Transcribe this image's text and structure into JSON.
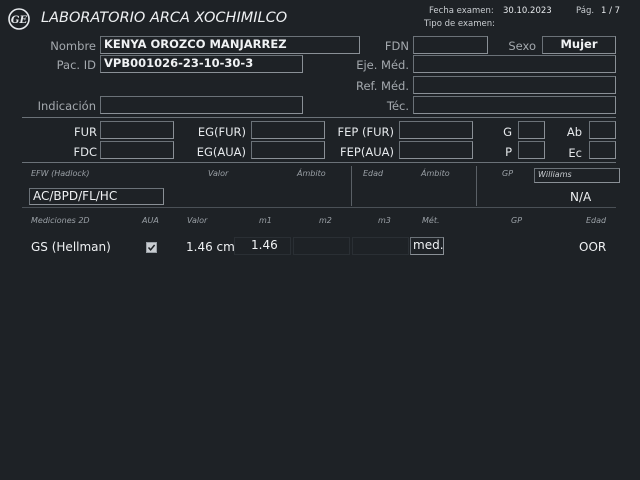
{
  "header": {
    "title": "LABORATORIO ARCA XOCHIMILCO",
    "exam_date_label": "Fecha examen:",
    "exam_date": "30.10.2023",
    "exam_type_label": "Tipo de examen:",
    "page_label": "Pág.",
    "page": "1 / 7"
  },
  "patient": {
    "name_label": "Nombre",
    "name": "KENYA OROZCO MANJARREZ",
    "dob_label": "FDN",
    "dob": "",
    "sex_label": "Sexo",
    "sex": "Mujer",
    "id_label": "Pac. ID",
    "id": "VPB001026-23-10-30-3",
    "exec_doc_label": "Eje. Méd.",
    "exec_doc": "",
    "ref_doc_label": "Ref. Méd.",
    "ref_doc": "",
    "indication_label": "Indicación",
    "indication": "",
    "tech_label": "Téc.",
    "tech": ""
  },
  "dates": {
    "fur_label": "FUR",
    "fur": "",
    "eg_fur_label": "EG(FUR)",
    "eg_fur": "",
    "fep_fur_label": "FEP (FUR)",
    "fep_fur": "",
    "g_label": "G",
    "g": "",
    "ab_label": "Ab",
    "ab": "",
    "fdc_label": "FDC",
    "fdc": "",
    "eg_aua_label": "EG(AUA)",
    "eg_aua": "",
    "fep_aua_label": "FEP(AUA)",
    "fep_aua": "",
    "p_label": "P",
    "p": "",
    "ec_label": "Ec",
    "ec": ""
  },
  "efw": {
    "col_efw": "EFW (Hadlock)",
    "col_valor": "Valor",
    "col_ambito": "Ámbito",
    "col_edad": "Edad",
    "col_ambito2": "Ámbito",
    "col_gp": "GP",
    "gp_method": "Williams",
    "formula": "AC/BPD/FL/HC",
    "gp_value": "N/A"
  },
  "measurements": {
    "col_name": "Mediciones 2D",
    "col_aua": "AUA",
    "col_valor": "Valor",
    "col_m1": "m1",
    "col_m2": "m2",
    "col_m3": "m3",
    "col_met": "Mét.",
    "col_gp": "GP",
    "col_edad": "Edad",
    "rows": [
      {
        "name": "GS (Hellman)",
        "aua_checked": true,
        "valor": "1.46 cm",
        "m1": "1.46",
        "m2": "",
        "m3": "",
        "met": "med.",
        "gp": "",
        "edad": "OOR"
      }
    ]
  }
}
